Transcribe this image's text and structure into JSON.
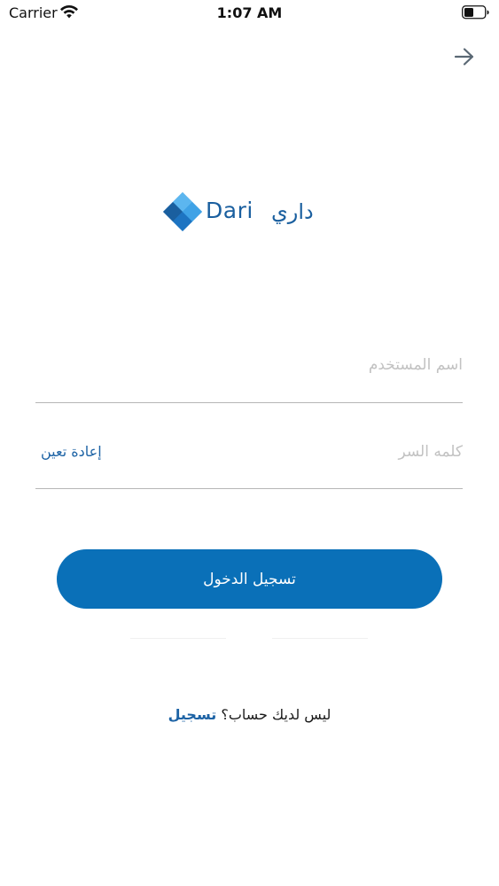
{
  "status_bar": {
    "carrier": "Carrier",
    "time": "1:07 AM",
    "wifi_icon": "wifi-icon",
    "battery_icon": "battery-icon",
    "battery_level": 0.45
  },
  "navigation": {
    "back_icon": "arrow-right-icon"
  },
  "logo": {
    "latin_text": "Dari",
    "arabic_text": "داري",
    "colors": [
      "#1a5f9f",
      "#2a8fd6",
      "#5cb6ef"
    ]
  },
  "form": {
    "username_placeholder": "اسم المستخدم",
    "password_placeholder": "كلمه السر",
    "reset_label": "إعادة تعين",
    "login_label": "تسجيل الدخول"
  },
  "signup": {
    "prompt": "ليس لديك حساب؟",
    "link_label": "تسجيل"
  },
  "colors": {
    "accent": "#0a70b8",
    "link": "#1d63a5",
    "placeholder": "#c2c2c2",
    "underline": "#b6b6b6"
  }
}
